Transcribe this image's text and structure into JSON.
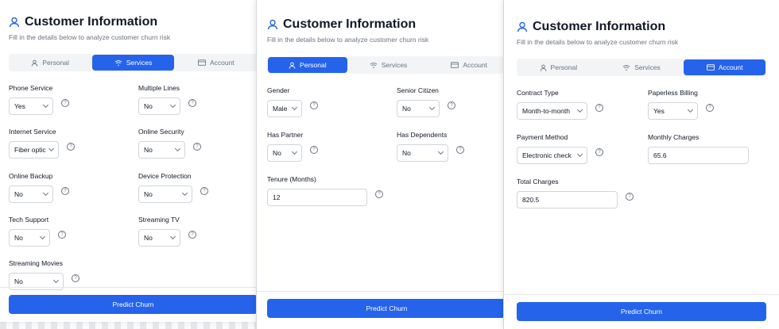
{
  "header": {
    "title": "Customer Information",
    "subtitle": "Fill in the details below to analyze customer churn risk"
  },
  "tabs": {
    "personal": "Personal",
    "services": "Services",
    "account": "Account"
  },
  "help_glyph": "?",
  "predict_label": "Predict Churn",
  "services": {
    "phone_service": {
      "label": "Phone Service",
      "value": "Yes"
    },
    "multiple_lines": {
      "label": "Multiple Lines",
      "value": "No"
    },
    "internet_service": {
      "label": "Internet Service",
      "value": "Fiber optic"
    },
    "online_security": {
      "label": "Online Security",
      "value": "No"
    },
    "online_backup": {
      "label": "Online Backup",
      "value": "No"
    },
    "device_protection": {
      "label": "Device Protection",
      "value": "No"
    },
    "tech_support": {
      "label": "Tech Support",
      "value": "No"
    },
    "streaming_tv": {
      "label": "Streaming TV",
      "value": "No"
    },
    "streaming_movies": {
      "label": "Streaming Movies",
      "value": "No"
    }
  },
  "personal": {
    "gender": {
      "label": "Gender",
      "value": "Male"
    },
    "senior_citizen": {
      "label": "Senior Citizen",
      "value": "No"
    },
    "has_partner": {
      "label": "Has Partner",
      "value": "No"
    },
    "has_dependents": {
      "label": "Has Dependents",
      "value": "No"
    },
    "tenure": {
      "label": "Tenure (Months)",
      "value": "12"
    }
  },
  "account": {
    "contract_type": {
      "label": "Contract Type",
      "value": "Month-to-month"
    },
    "paperless_billing": {
      "label": "Paperless Billing",
      "value": "Yes"
    },
    "payment_method": {
      "label": "Payment Method",
      "value": "Electronic check"
    },
    "monthly_charges": {
      "label": "Monthly Charges",
      "value": "65.6"
    },
    "total_charges": {
      "label": "Total Charges",
      "value": "820.5"
    }
  },
  "colors": {
    "accent": "#2563eb",
    "border": "#d1d5db",
    "muted": "#6b7280"
  },
  "icons": {
    "title": "user-icon",
    "personal": "user-icon",
    "services": "wifi-icon",
    "account": "credit-card-icon",
    "help": "help-icon"
  }
}
